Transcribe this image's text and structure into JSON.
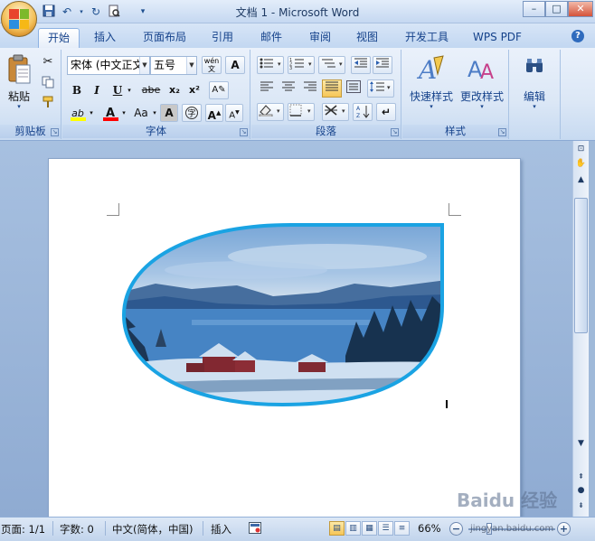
{
  "window": {
    "title": "文档 1 - Microsoft Word",
    "controls": {
      "minimize": "–",
      "maximize": "□",
      "close": "✕"
    }
  },
  "quick_access": {
    "save_icon": "save-icon",
    "undo_icon": "undo-icon",
    "redo_icon": "redo-icon",
    "print_preview_icon": "print-preview-icon",
    "customize": "▾"
  },
  "tabs": [
    {
      "label": "开始",
      "active": true
    },
    {
      "label": "插入"
    },
    {
      "label": "页面布局"
    },
    {
      "label": "引用"
    },
    {
      "label": "邮件"
    },
    {
      "label": "审阅"
    },
    {
      "label": "视图"
    },
    {
      "label": "开发工具"
    },
    {
      "label": "WPS PDF"
    }
  ],
  "ribbon": {
    "clipboard": {
      "label": "剪贴板",
      "paste": "粘贴"
    },
    "font": {
      "label": "字体",
      "font_name": "宋体 (中文正文",
      "font_size": "五号",
      "wen": "wén",
      "bold": "B",
      "italic": "I",
      "underline": "U",
      "strike": "abe",
      "subscript": "x₂",
      "superscript": "x²",
      "change_case": "Aa",
      "grow": "A",
      "shrink": "A",
      "font_color": "A",
      "highlight": "ab"
    },
    "paragraph": {
      "label": "段落"
    },
    "styles": {
      "label": "样式",
      "quick_styles": "快速样式",
      "change_styles": "更改样式"
    },
    "editing": {
      "label": "编辑"
    }
  },
  "document": {
    "image_shape": "teardrop",
    "image_subject": "winter lake with red houses",
    "accent": "#1aa3e3"
  },
  "status": {
    "page": "页面: 1/1",
    "words": "字数: 0",
    "language": "中文(简体，中国)",
    "mode": "插入",
    "zoom": "66%"
  },
  "watermark": {
    "text": "Baidu 经验",
    "url": "jingyan.baidu.com"
  },
  "colors": {
    "ribbon_bg": "#dbe7f6",
    "tab_text": "#15428b",
    "shape_border": "#1aa3e3",
    "font_color_bar": "#ff0000",
    "highlight_bar": "#ffff00"
  }
}
